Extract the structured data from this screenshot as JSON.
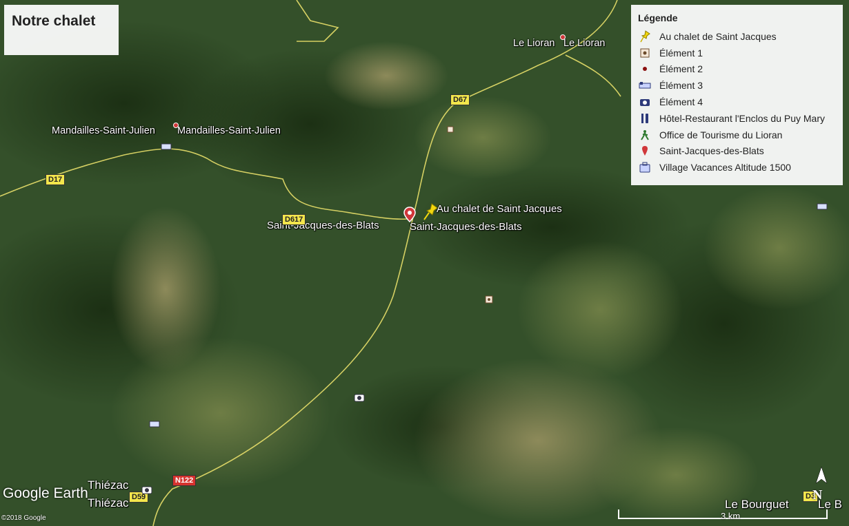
{
  "title": "Notre chalet",
  "legend": {
    "heading": "Légende",
    "items": [
      {
        "icon": "yellow-pushpin-icon",
        "label": "Au chalet de Saint Jacques"
      },
      {
        "icon": "square-dot-icon",
        "label": "Élément 1"
      },
      {
        "icon": "red-dot-icon",
        "label": "Élément 2"
      },
      {
        "icon": "bed-icon",
        "label": "Élément 3"
      },
      {
        "icon": "camera-icon",
        "label": "Élément 4"
      },
      {
        "icon": "restaurant-icon",
        "label": "Hôtel-Restaurant l'Enclos du Puy Mary"
      },
      {
        "icon": "hiker-icon",
        "label": "Office de Tourisme du Lioran"
      },
      {
        "icon": "red-pin-icon",
        "label": "Saint-Jacques-des-Blats"
      },
      {
        "icon": "suitcase-icon",
        "label": "Village Vacances Altitude 1500"
      }
    ]
  },
  "places": {
    "le_lioran_1": "Le Lioran",
    "le_lioran_2": "Le Lioran",
    "mandailles_1": "Mandailles-Saint-Julien",
    "mandailles_2": "Mandailles-Saint-Julien",
    "chalet": "Au chalet de Saint Jacques",
    "sjdb_1": "Saint-Jacques-des-Blats",
    "sjdb_2": "Saint-Jacques-des-Blats",
    "thiezac_1": "Thiézac",
    "thiezac_2": "Thiézac",
    "bourguet_1": "Le Bourguet",
    "bourguet_2": "Le B"
  },
  "roads": {
    "d67": "D67",
    "d17": "D17",
    "d617": "D617",
    "d59": "D59",
    "n122": "N122",
    "d3": "D3"
  },
  "footer": {
    "brand": "Google Earth",
    "copyright": "©2018 Google",
    "scale": "3 km",
    "north": "N"
  },
  "colors": {
    "terrain_dark": "#243a1a",
    "terrain_mid": "#3f5c2c",
    "terrain_light": "#6f7f44",
    "road": "#e8df6a",
    "pin_red": "#d0373a",
    "pushpin_yellow": "#f2d70f"
  }
}
